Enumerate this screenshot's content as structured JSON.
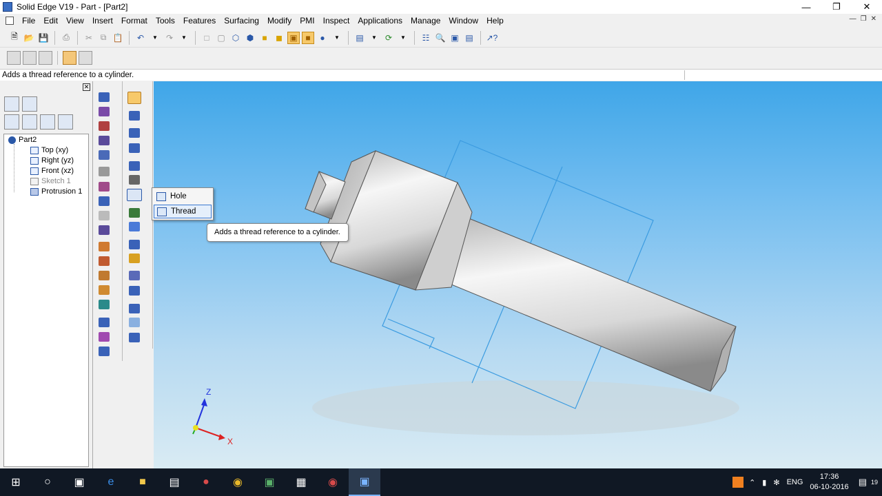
{
  "window": {
    "title": "Solid Edge V19 - Part - [Part2]",
    "controls": [
      "minimize-icon",
      "restore-icon",
      "close-icon"
    ]
  },
  "menu": [
    "File",
    "Edit",
    "View",
    "Insert",
    "Format",
    "Tools",
    "Features",
    "Surfacing",
    "Modify",
    "PMI",
    "Inspect",
    "Applications",
    "Manage",
    "Window",
    "Help"
  ],
  "prompt_bar": {
    "text": "Adds a thread reference to a cylinder."
  },
  "feature_tree": {
    "root": "Part2",
    "items": [
      {
        "label": "Top (xy)"
      },
      {
        "label": "Right (yz)"
      },
      {
        "label": "Front (xz)"
      },
      {
        "label": "Sketch 1"
      },
      {
        "label": "Protrusion 1"
      }
    ]
  },
  "hole_flyout": {
    "items": [
      {
        "label": "Hole",
        "icon": "hole-icon"
      },
      {
        "label": "Thread",
        "icon": "thread-icon",
        "highlighted": true
      }
    ]
  },
  "tooltip": {
    "text": "Adds a thread reference to a cylinder."
  },
  "triad": {
    "z": "Z",
    "x": "X"
  },
  "taskbar": {
    "apps": [
      "windows-start-icon",
      "cortana-icon",
      "task-view-icon",
      "edge-icon",
      "file-explorer-icon",
      "store-icon",
      "app-icon",
      "chrome-icon",
      "photos-icon",
      "app2-icon",
      "chrome2-icon",
      "solid-edge-icon"
    ],
    "language": "ENG",
    "time": "17:36",
    "date": "06-10-2016",
    "notifications": "19"
  },
  "colors": {
    "viewport_top": "#3fa6e8",
    "viewport_bottom": "#d9ebf3",
    "highlight": "#f7c96a",
    "sketch_line": "#3b9be0"
  }
}
